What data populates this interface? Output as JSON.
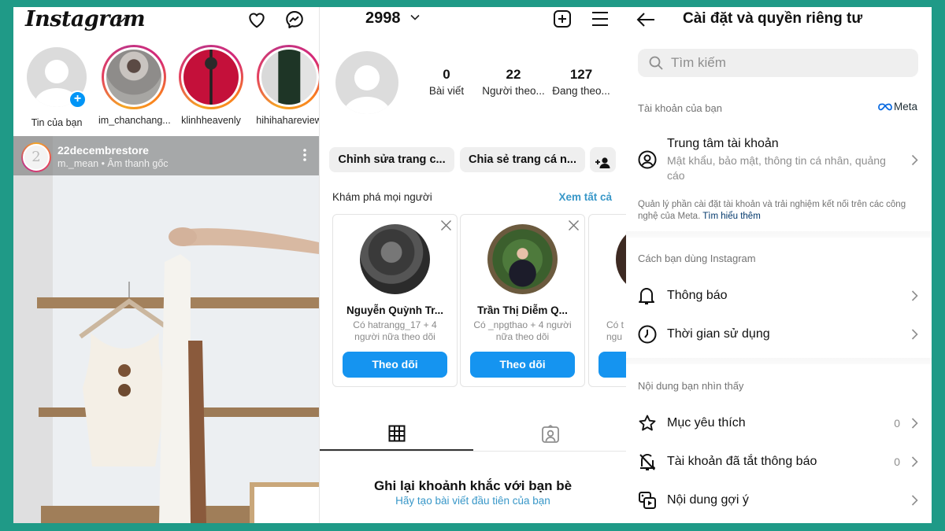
{
  "feed": {
    "logo_text": "Instagram",
    "stories": [
      {
        "label": "Tin của bạn",
        "own": true
      },
      {
        "label": "im_chanchang...",
        "own": false
      },
      {
        "label": "klinhheavenly",
        "own": false
      },
      {
        "label": "hihihahareview",
        "own": false
      }
    ],
    "post": {
      "avatar_text": "2",
      "username": "22decembrestore",
      "subtitle": "m._mean • Âm thanh gốc"
    }
  },
  "profile": {
    "username": "2998",
    "stats": [
      {
        "value": "0",
        "label": "Bài viết"
      },
      {
        "value": "22",
        "label": "Người theo..."
      },
      {
        "value": "127",
        "label": "Đang theo..."
      }
    ],
    "buttons": {
      "edit": "Chỉnh sửa trang c...",
      "share": "Chia sẻ trang cá n..."
    },
    "discover": {
      "title": "Khám phá mọi người",
      "see_all": "Xem tất cả",
      "cards": [
        {
          "name": "Nguyễn Quỳnh Tr...",
          "subtitle": "Có hatrangg_17 + 4 người nữa theo dõi",
          "button": "Theo dõi"
        },
        {
          "name": "Trần Thị Diễm Q...",
          "subtitle": "Có _npgthao + 4 người nữa theo dõi",
          "button": "Theo dõi"
        },
        {
          "name": "",
          "subtitle": "Có t ngu",
          "button": "Theo dõi"
        }
      ]
    },
    "empty": {
      "title": "Ghi lại khoảnh khắc với bạn bè",
      "subtitle": "Hãy tạo bài viết đầu tiên của bạn"
    }
  },
  "settings": {
    "title": "Cài đặt và quyền riêng tư",
    "search_placeholder": "Tìm kiếm",
    "section_account": "Tài khoản của bạn",
    "meta_label": "Meta",
    "account_center": {
      "title": "Trung tâm tài khoản",
      "description": "Mật khẩu, bảo mật, thông tin cá nhân, quảng cáo"
    },
    "account_note": "Quản lý phần cài đặt tài khoản và trải nghiệm kết nối trên các công nghệ của Meta.",
    "account_note_link": "Tìm hiểu thêm",
    "section_usage": "Cách bạn dùng Instagram",
    "usage_items": [
      {
        "label": "Thông báo",
        "icon": "bell-icon"
      },
      {
        "label": "Thời gian sử dụng",
        "icon": "clock-icon"
      }
    ],
    "section_content": "Nội dung bạn nhìn thấy",
    "content_items": [
      {
        "label": "Mục yêu thích",
        "count": "0",
        "icon": "star-icon"
      },
      {
        "label": "Tài khoản đã tắt thông báo",
        "count": "0",
        "icon": "bell-off-icon"
      },
      {
        "label": "Nội dung gợi ý",
        "count": "",
        "icon": "suggested-content-icon"
      }
    ]
  },
  "colors": {
    "background_frame": "#1f9a87",
    "follow_button": "#1594f0",
    "link_blue": "#3897c8",
    "add_badge": "#0095f6"
  }
}
